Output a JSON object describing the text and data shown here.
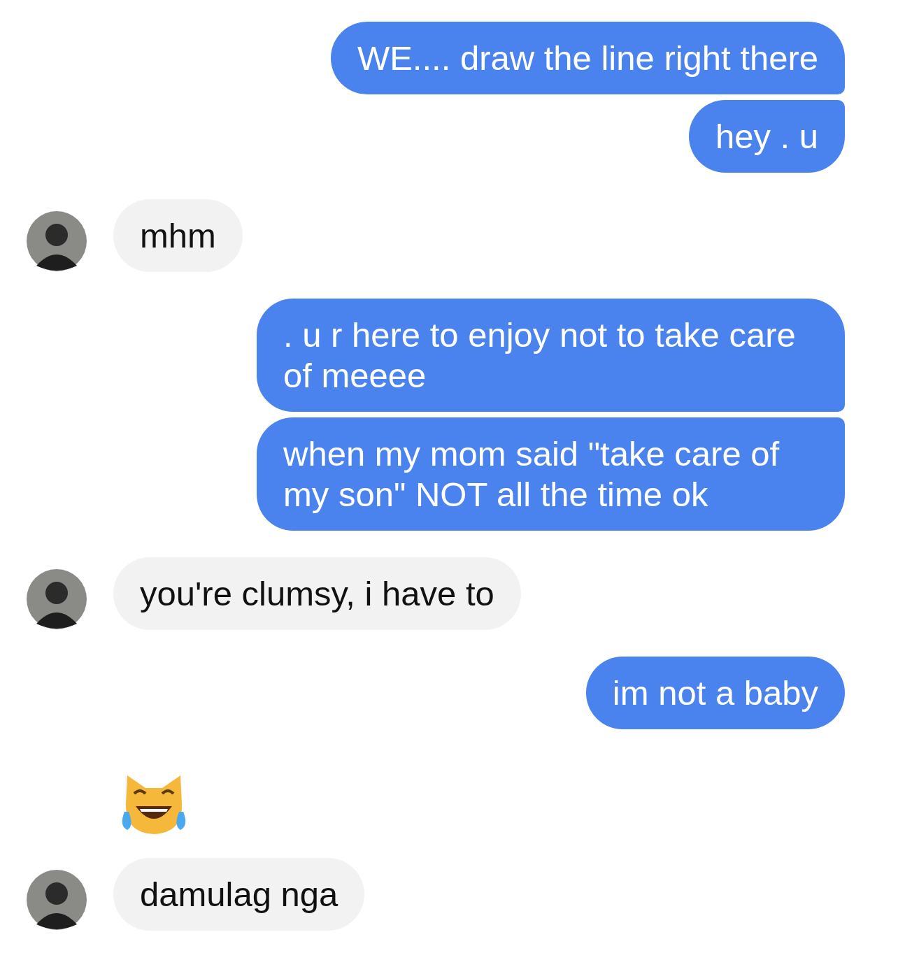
{
  "messages": [
    {
      "outgoing": true,
      "kind": "text",
      "text": "WE.... draw the line right there"
    },
    {
      "outgoing": true,
      "kind": "text",
      "text": "hey . u"
    },
    {
      "outgoing": false,
      "kind": "text",
      "text": "mhm"
    },
    {
      "outgoing": true,
      "kind": "text",
      "text": ". u r here to enjoy not to take care of meeee"
    },
    {
      "outgoing": true,
      "kind": "text",
      "text": "when my mom said \"take care of my son\" NOT all the time ok"
    },
    {
      "outgoing": false,
      "kind": "text",
      "text": "you're clumsy, i have to"
    },
    {
      "outgoing": true,
      "kind": "text",
      "text": "im not a baby"
    },
    {
      "outgoing": false,
      "kind": "emoji"
    },
    {
      "outgoing": false,
      "kind": "text",
      "text": "damulag nga"
    }
  ]
}
